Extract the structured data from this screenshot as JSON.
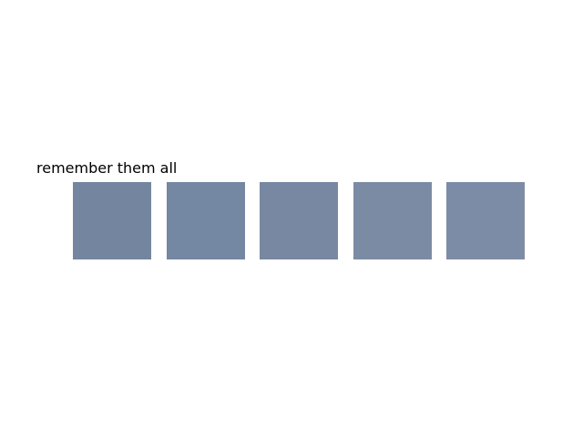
{
  "instruction": {
    "text": "remember them all"
  },
  "tiles": [
    {
      "color": "#74869f"
    },
    {
      "color": "#7487a3"
    },
    {
      "color": "#7888a3"
    },
    {
      "color": "#7c8ba4"
    },
    {
      "color": "#7d8ca6"
    }
  ]
}
